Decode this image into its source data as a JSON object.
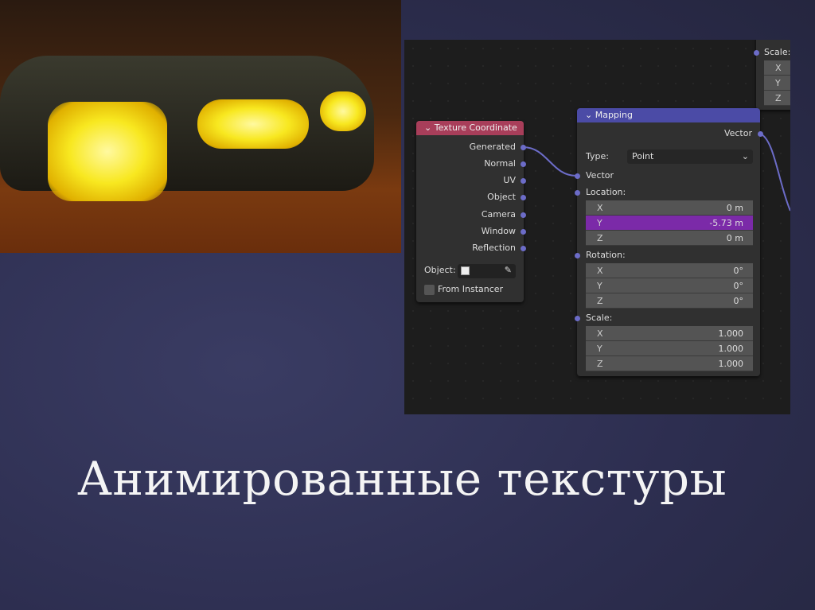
{
  "slide": {
    "title": "Анимированные текстуры"
  },
  "texture_node": {
    "title": "Texture Coordinate",
    "outputs": [
      "Generated",
      "Normal",
      "UV",
      "Object",
      "Camera",
      "Window",
      "Reflection"
    ],
    "object_label": "Object:",
    "from_instancer": "From Instancer"
  },
  "mapping_node": {
    "title": "Mapping",
    "output": "Vector",
    "type_label": "Type:",
    "type_value": "Point",
    "vector_input": "Vector",
    "location": {
      "label": "Location:",
      "rows": [
        {
          "axis": "X",
          "value": "0 m"
        },
        {
          "axis": "Y",
          "value": "-5.73 m"
        },
        {
          "axis": "Z",
          "value": "0 m"
        }
      ]
    },
    "rotation": {
      "label": "Rotation:",
      "rows": [
        {
          "axis": "X",
          "value": "0°"
        },
        {
          "axis": "Y",
          "value": "0°"
        },
        {
          "axis": "Z",
          "value": "0°"
        }
      ]
    },
    "scale": {
      "label": "Scale:",
      "rows": [
        {
          "axis": "X",
          "value": "1.000"
        },
        {
          "axis": "Y",
          "value": "1.000"
        },
        {
          "axis": "Z",
          "value": "1.000"
        }
      ]
    }
  },
  "side_node": {
    "scale_label": "Scale:",
    "axes": [
      "X",
      "Y",
      "Z"
    ]
  },
  "colors": {
    "texture_header": "#a83e5a",
    "mapping_header": "#4b4ba6",
    "highlight": "#7b2aa8",
    "socket": "#6c6cc8"
  }
}
